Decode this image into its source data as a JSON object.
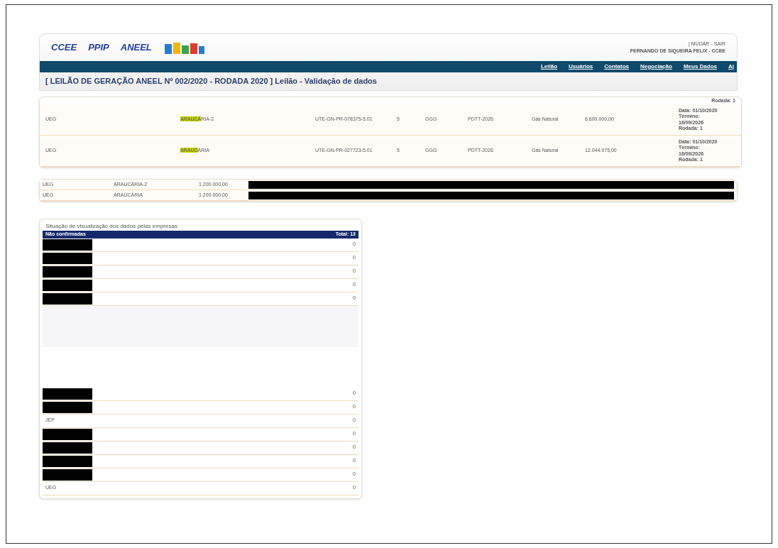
{
  "header": {
    "logos": [
      "CCEE",
      "PPIP",
      "ANEEL"
    ],
    "user_links": "| MUDAR - SAIR",
    "user_name": "FERNANDO DE SIQUEIRA FELIX - CCEE",
    "nav": [
      "Leilão",
      "Usuários",
      "Contatos",
      "Negociação",
      "Meus Dados",
      "Aj"
    ],
    "title": "[ LEILÃO DE GERAÇÃO ANEEL Nº 002/2020 - RODADA 2020 ] Leilão - Validação de dados"
  },
  "lots": {
    "top_note": "Rodada: 1",
    "rows": [
      {
        "cells": [
          "UEG",
          "UTE-GN-PR-078375-5.01",
          "5",
          "GGG",
          "PDTT-2026",
          "Gás Natural",
          "6.600.000,00"
        ],
        "name_highlight": "ARAUCÁ",
        "name_rest": "RIA-2",
        "notes": [
          "Data: 01/10/2020",
          "Término:",
          "16/09/2026",
          "Rodada: 1"
        ]
      },
      {
        "cells": [
          "UEG",
          "UTE-GN-PR-027723-5.01",
          "5",
          "GGG",
          "PDTT-2026",
          "Gás Natural",
          "12.044.975,00"
        ],
        "name_highlight": "ARAUC",
        "name_rest": "ÁRIA",
        "notes": [
          "Data: 01/10/2020",
          "Término:",
          "16/09/2026",
          "Rodada: 1"
        ]
      }
    ]
  },
  "bids": [
    {
      "cells": [
        "UEG",
        "ARAUCÁRIA-2",
        "1.200.000,00"
      ],
      "redacted": true
    },
    {
      "cells": [
        "UEG",
        "ARAUCÁRIA",
        "1.200.000,00"
      ],
      "redacted": true
    }
  ],
  "companies": {
    "title": "Situação de visualização dos dados pelas empresas",
    "header": "Não confirmadas",
    "total": "Total: 13",
    "groups": [
      [
        {
          "redacted": true,
          "count": "0"
        },
        {
          "redacted": true,
          "count": "0"
        },
        {
          "redacted": true,
          "count": "0"
        },
        {
          "redacted": true,
          "count": "0"
        },
        {
          "redacted": true,
          "count": "0"
        }
      ],
      [
        {
          "redacted": true,
          "count": "0"
        },
        {
          "redacted": true,
          "count": "0"
        },
        {
          "redacted": false,
          "name": "JEP",
          "count": "0"
        },
        {
          "redacted": true,
          "count": "0"
        },
        {
          "redacted": true,
          "count": "0"
        },
        {
          "redacted": true,
          "count": "0"
        },
        {
          "redacted": true,
          "count": "0"
        },
        {
          "redacted": false,
          "name": "UEG",
          "count": "0"
        }
      ]
    ]
  }
}
